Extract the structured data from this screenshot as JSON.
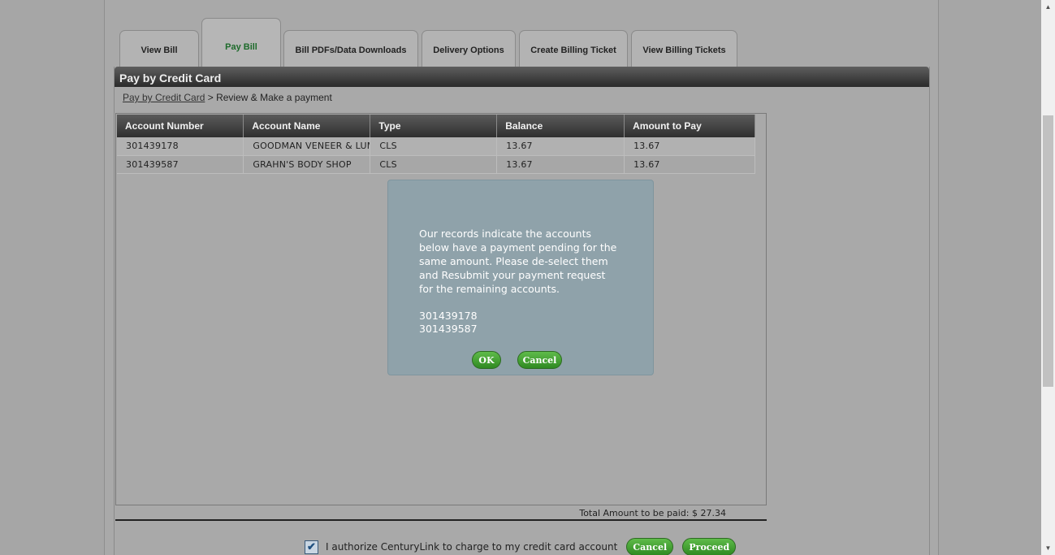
{
  "tabs": [
    {
      "label": "View Bill"
    },
    {
      "label": "Pay Bill"
    },
    {
      "label": "Bill PDFs/Data Downloads"
    },
    {
      "label": "Delivery Options"
    },
    {
      "label": "Create Billing Ticket"
    },
    {
      "label": "View Billing Tickets"
    }
  ],
  "panel": {
    "title": "Pay by Credit Card",
    "breadcrumb": {
      "link": "Pay by Credit Card",
      "separator": " > ",
      "current": "Review & Make a payment"
    }
  },
  "table": {
    "headers": [
      "Account Number",
      "Account Name",
      "Type",
      "Balance",
      "Amount to Pay"
    ],
    "rows": [
      [
        "301439178",
        "GOODMAN VENEER & LUMBER",
        "CLS",
        "13.67",
        "13.67"
      ],
      [
        "301439587",
        "GRAHN'S BODY SHOP",
        "CLS",
        "13.67",
        "13.67"
      ]
    ]
  },
  "total": "Total Amount to be paid: $ 27.34",
  "authorize": {
    "checked": true,
    "label": "I authorize CenturyLink to charge to my credit card account"
  },
  "footer_buttons": {
    "cancel": "Cancel",
    "proceed": "Proceed"
  },
  "modal": {
    "message": "Our records indicate the accounts below have a payment pending for the same amount. Please de-select them and Resubmit your payment request for the remaining accounts.",
    "accounts": [
      "301439178",
      "301439587"
    ],
    "ok": "OK",
    "cancel": "Cancel"
  },
  "colors": {
    "accent_green": "#2f8a22",
    "active_tab_text": "#1d6b2b",
    "modal_bg": "#8fa2aa"
  }
}
